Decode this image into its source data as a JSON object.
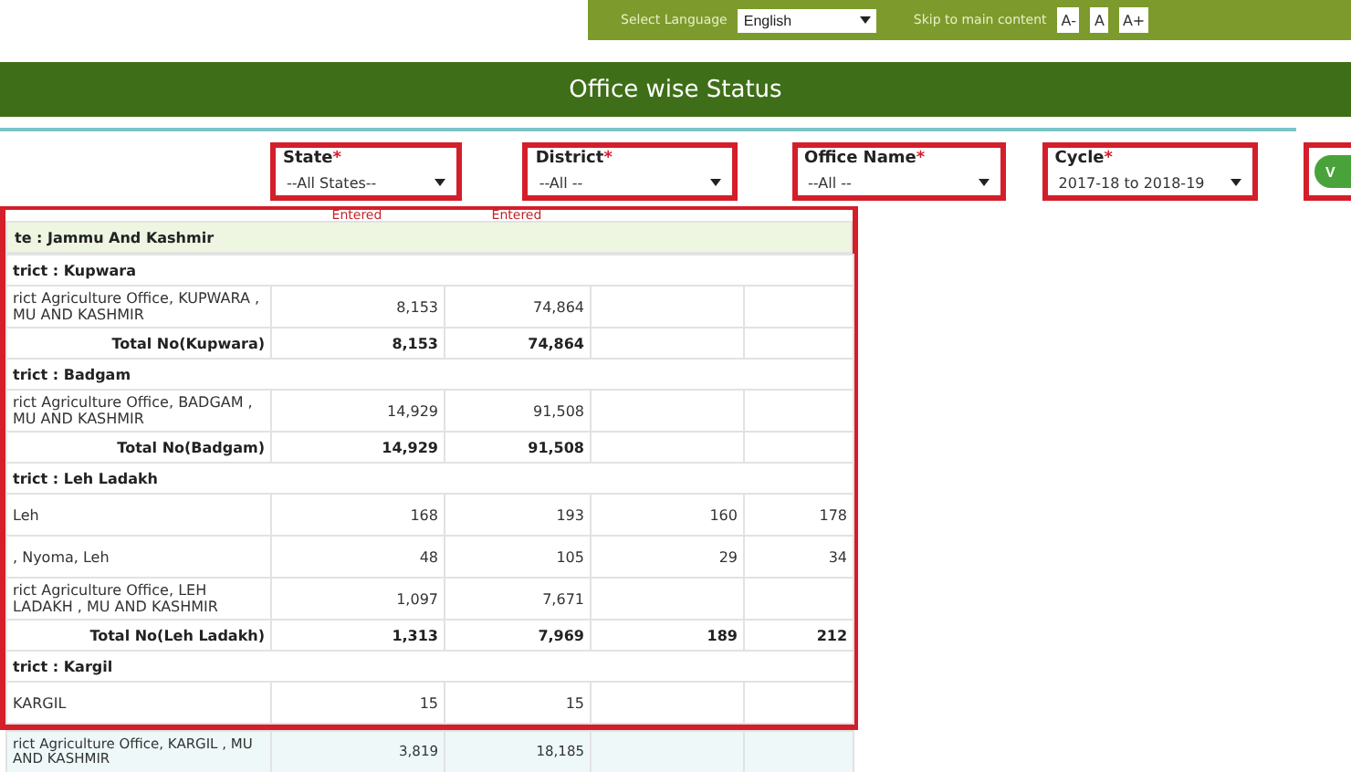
{
  "topbar": {
    "language_label": "Select Language",
    "language": "English",
    "skip_link": "Skip to main content",
    "font_buttons": [
      "A-",
      "A",
      "A+"
    ]
  },
  "title": "Office wise Status",
  "filters": [
    {
      "label": "State",
      "required_mark": "*",
      "value": "--All States--"
    },
    {
      "label": "District",
      "required_mark": "*",
      "value": "--All --"
    },
    {
      "label": "Office Name",
      "required_mark": "*",
      "value": "--All --"
    },
    {
      "label": "Cycle",
      "required_mark": "*",
      "value": "2017-18 to 2018-19"
    }
  ],
  "submit_button": "V",
  "table": {
    "header": {
      "column_2": "Entered",
      "column_3": "Entered"
    },
    "state_heading": "te : Jammu And Kashmir",
    "districts": [
      {
        "heading": "trict : Kupwara",
        "rows": [
          {
            "kind": "office",
            "cells": [
              "rict Agriculture Office, KUPWARA , MU AND KASHMIR",
              "8,153",
              "74,864",
              "",
              ""
            ]
          },
          {
            "kind": "total",
            "cells": [
              "Total No(Kupwara)",
              "8,153",
              "74,864",
              "",
              ""
            ]
          }
        ]
      },
      {
        "heading": "trict : Badgam",
        "rows": [
          {
            "kind": "office",
            "cells": [
              "rict Agriculture Office, BADGAM , MU AND KASHMIR",
              "14,929",
              "91,508",
              "",
              ""
            ]
          },
          {
            "kind": "total",
            "cells": [
              "Total No(Badgam)",
              "14,929",
              "91,508",
              "",
              ""
            ]
          }
        ]
      },
      {
        "heading": "trict : Leh Ladakh",
        "rows": [
          {
            "kind": "office",
            "cells": [
              "Leh",
              "168",
              "193",
              "160",
              "178"
            ]
          },
          {
            "kind": "office",
            "cells": [
              ", Nyoma, Leh",
              "48",
              "105",
              "29",
              "34"
            ]
          },
          {
            "kind": "office",
            "cells": [
              "rict Agriculture Office, LEH LADAKH , MU AND KASHMIR",
              "1,097",
              "7,671",
              "",
              ""
            ]
          },
          {
            "kind": "total",
            "cells": [
              "Total No(Leh Ladakh)",
              "1,313",
              "7,969",
              "189",
              "212"
            ]
          }
        ]
      },
      {
        "heading": "trict : Kargil",
        "rows": [
          {
            "kind": "office",
            "cells": [
              "KARGIL",
              "15",
              "15",
              "",
              ""
            ]
          }
        ]
      }
    ],
    "below_rows": [
      {
        "kind": "office",
        "cells": [
          "rict Agriculture Office, KARGIL , MU AND KASHMIR",
          "3,819",
          "18,185",
          "",
          ""
        ]
      }
    ]
  }
}
